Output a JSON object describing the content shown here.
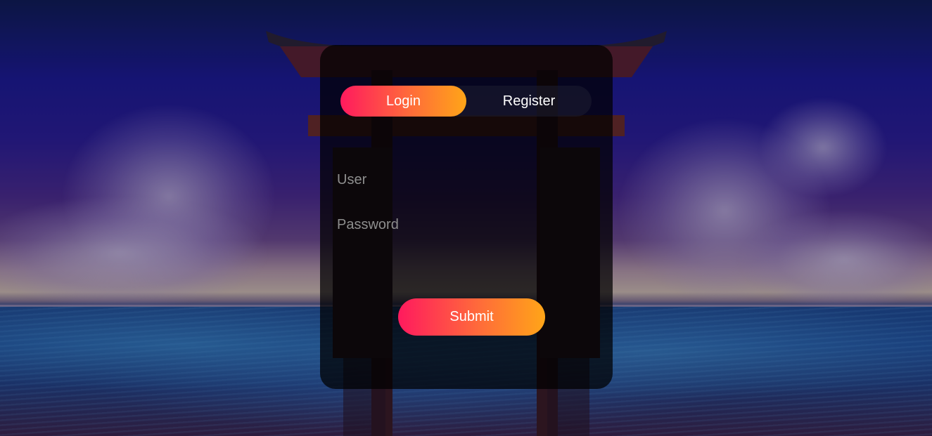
{
  "auth": {
    "tabs": {
      "login_label": "Login",
      "register_label": "Register",
      "active": "login"
    },
    "user_field": {
      "placeholder": "User",
      "value": ""
    },
    "password_field": {
      "placeholder": "Password",
      "value": ""
    },
    "submit_label": "Submit"
  },
  "colors": {
    "gradient_start": "#ff1a5e",
    "gradient_end": "#ffa518",
    "panel_bg": "#000000"
  },
  "background": {
    "scene": "torii-gate-at-sea-at-dusk"
  }
}
